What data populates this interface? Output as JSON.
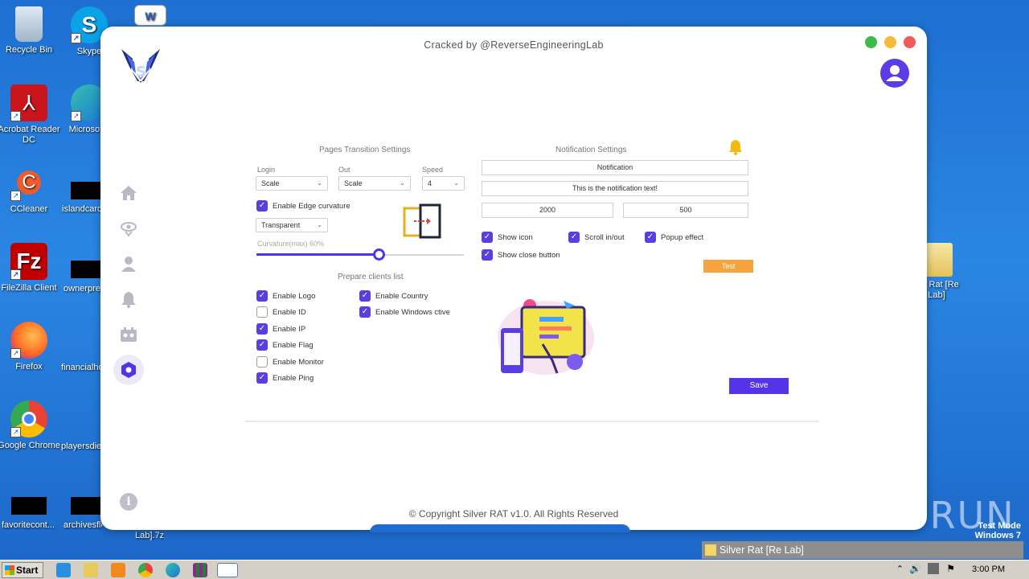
{
  "desktop": {
    "icons": [
      {
        "label": "Recycle Bin"
      },
      {
        "label": "Skype"
      },
      {
        "label": "Acrobat Reader DC"
      },
      {
        "label": "Microsoft I"
      },
      {
        "label": "CCleaner"
      },
      {
        "label": "islandcard.j"
      },
      {
        "label": "FileZilla Client"
      },
      {
        "label": "ownerpres"
      },
      {
        "label": "Firefox"
      },
      {
        "label": "financialhot"
      },
      {
        "label": "Google Chrome"
      },
      {
        "label": "playersdie"
      },
      {
        "label": "favoritecont..."
      },
      {
        "label": "archivesflo"
      },
      {
        "label": "ver Rat [Re Lab]"
      },
      {
        "label": "Lab].7z"
      }
    ]
  },
  "window": {
    "cracked_by": "Cracked by @ReverseEngineeringLab",
    "copyright": "© Copyright Silver RAT v1.0. All Rights Reserved",
    "dot_colors": [
      "#3fba4a",
      "#f5bb3a",
      "#ef5a5a"
    ],
    "accent": "#5533e8"
  },
  "sidebar": {
    "items": [
      {
        "icon": "home-icon"
      },
      {
        "icon": "eye-icon"
      },
      {
        "icon": "user-icon"
      },
      {
        "icon": "bell-icon"
      },
      {
        "icon": "robot-icon"
      },
      {
        "icon": "hexagon-settings-icon",
        "active": true
      }
    ]
  },
  "transition": {
    "title": "Pages Transition Settings",
    "login_label": "Login",
    "login_value": "Scale",
    "out_label": "Out",
    "out_value": "Scale",
    "speed_label": "Speed",
    "speed_value": "4",
    "edge_curvature": "Enable Edge curvature",
    "edge_curvature_checked": true,
    "mode_value": "Transparent",
    "curvature_label": "Curvature(max) 60%",
    "curvature_fraction": 0.6
  },
  "clients": {
    "title": "Prepare clients list",
    "options": [
      {
        "label": "Enable Logo",
        "checked": true
      },
      {
        "label": "Enable ID",
        "checked": false
      },
      {
        "label": "Enable IP",
        "checked": true
      },
      {
        "label": "Enable Flag",
        "checked": true
      },
      {
        "label": "Enable Monitor",
        "checked": false
      },
      {
        "label": "Enable Ping",
        "checked": true
      },
      {
        "label": "Enable Country",
        "checked": true
      },
      {
        "label": "Enable Windows ctive",
        "checked": true
      }
    ]
  },
  "notification": {
    "title": "Notification Settings",
    "title_value": "Notification",
    "text_value": "This is the notification text!",
    "duration_value": "2000",
    "delay_value": "500",
    "show_icon": "Show icon",
    "scroll": "Scroll in/out",
    "popup": "Popup effect",
    "close_button": "Show close button",
    "test_label": "Test",
    "save_label": "Save"
  },
  "taskbar": {
    "start_label": "Start",
    "window_title": "Silver Rat [Re Lab]",
    "clock": "3:00 PM"
  },
  "watermark": {
    "brand": "ANY RUN",
    "mode_line1": "Test Mode",
    "mode_line2": "Windows 7"
  }
}
